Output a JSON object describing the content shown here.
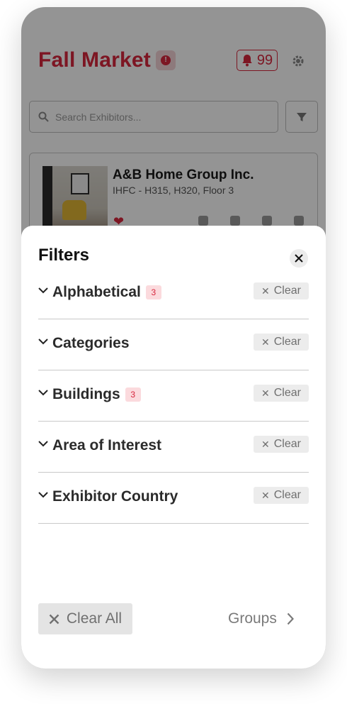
{
  "app": {
    "title": "Fall Market",
    "notification_count": "99",
    "search_placeholder": "Search Exhibitors...",
    "card": {
      "title": "A&B Home Group Inc.",
      "subtitle": "IHFC - H315, H320, Floor 3"
    },
    "accent_color": "#d7263d"
  },
  "sheet": {
    "title": "Filters",
    "filters": [
      {
        "label": "Alphabetical",
        "count": "3",
        "clear_label": "Clear"
      },
      {
        "label": "Categories",
        "count": "",
        "clear_label": "Clear"
      },
      {
        "label": "Buildings",
        "count": "3",
        "clear_label": "Clear"
      },
      {
        "label": "Area of Interest",
        "count": "",
        "clear_label": "Clear"
      },
      {
        "label": "Exhibitor Country",
        "count": "",
        "clear_label": "Clear"
      }
    ],
    "clear_all_label": "Clear All",
    "groups_label": "Groups"
  }
}
